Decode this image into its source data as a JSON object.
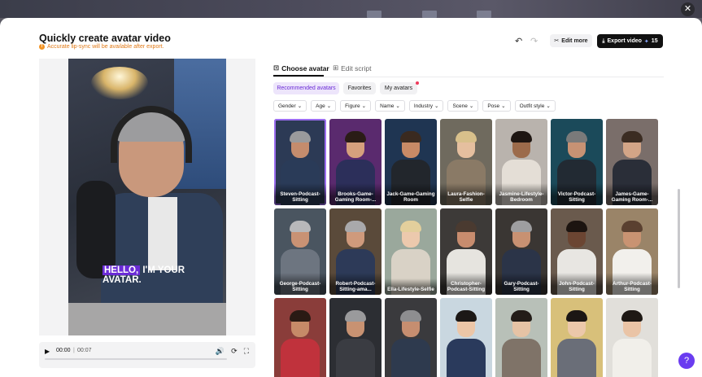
{
  "modal": {
    "title": "Quickly create avatar video",
    "warning": "Accurate lip-sync will be available after export.",
    "edit_more_label": "Edit more",
    "export_label": "Export video",
    "export_credits": "15"
  },
  "preview": {
    "caption_highlight": "HELLO,",
    "caption_line1_rest": " I'M YOUR",
    "caption_line2": "AVATAR."
  },
  "player": {
    "current_time": "00:00",
    "separator": "|",
    "duration": "00:07",
    "progress_fraction": 0.0
  },
  "tabs": [
    {
      "label": "Choose avatar",
      "active": true
    },
    {
      "label": "Edit script",
      "active": false
    }
  ],
  "segments": [
    {
      "label": "Recommended avatars",
      "active": true
    },
    {
      "label": "Favorites",
      "active": false
    },
    {
      "label": "My avatars",
      "active": false
    }
  ],
  "filters": [
    "Gender",
    "Age",
    "Figure",
    "Name",
    "Industry",
    "Scene",
    "Pose",
    "Outfit style"
  ],
  "avatars": [
    {
      "label": "Steven-Podcast-Sitting",
      "selected": true,
      "bg": "#2c3a55",
      "skin": "#c58c6d",
      "hair": "#9a9a9c",
      "cloth": "#2a3b58"
    },
    {
      "label": "Brooks-Game-Gaming Room-...",
      "selected": false,
      "bg": "#5a2a6e",
      "skin": "#d6a07d",
      "hair": "#2a1c16",
      "cloth": "#2c2f5a"
    },
    {
      "label": "Jack-Game-Gaming Room",
      "selected": false,
      "bg": "#1f3552",
      "skin": "#c88a66",
      "hair": "#3a2a20",
      "cloth": "#22262c"
    },
    {
      "label": "Laura-Fashion-Selfie",
      "selected": false,
      "bg": "#6f6a5e",
      "skin": "#e5bf9f",
      "hair": "#d8c08b",
      "cloth": "#8a7a66"
    },
    {
      "label": "Jasmine-Lifestyle-Bedroom",
      "selected": false,
      "bg": "#b9b3ad",
      "skin": "#9c6b4b",
      "hair": "#1e1612",
      "cloth": "#e4ded6"
    },
    {
      "label": "Victor-Podcast-Sitting",
      "selected": false,
      "bg": "#1b4a5a",
      "skin": "#c79274",
      "hair": "#7a7a7a",
      "cloth": "#222a33"
    },
    {
      "label": "James-Game-Gaming Room-...",
      "selected": false,
      "bg": "#7a6e6a",
      "skin": "#d3a587",
      "hair": "#3b2c22",
      "cloth": "#2a2e38"
    },
    {
      "label": "George-Podcast-Sitting",
      "selected": false,
      "bg": "#4a5560",
      "skin": "#c99274",
      "hair": "#b8b8ba",
      "cloth": "#6d7580"
    },
    {
      "label": "Robert-Podcast-Sitting-ama...",
      "selected": false,
      "bg": "#5a4a3a",
      "skin": "#cf9a7c",
      "hair": "#a9a9ab",
      "cloth": "#2d3a58"
    },
    {
      "label": "Ella-Lifestyle-Selfie",
      "selected": false,
      "bg": "#9aa89c",
      "skin": "#ecc9ad",
      "hair": "#e3cf9c",
      "cloth": "#d9d2c6"
    },
    {
      "label": "Christopher-Podcast-Sitting",
      "selected": false,
      "bg": "#3d3a38",
      "skin": "#c88c6e",
      "hair": "#4a3a30",
      "cloth": "#e6e4df"
    },
    {
      "label": "Gary-Podcast-Sitting",
      "selected": false,
      "bg": "#3a3633",
      "skin": "#c89172",
      "hair": "#9e9ea0",
      "cloth": "#2b3448"
    },
    {
      "label": "John-Podcast-Sitting",
      "selected": false,
      "bg": "#6a5a4d",
      "skin": "#6b4532",
      "hair": "#1c1410",
      "cloth": "#e8e6e2"
    },
    {
      "label": "Arthur-Podcast-Sitting",
      "selected": false,
      "bg": "#9a8468",
      "skin": "#c99372",
      "hair": "#5a4030",
      "cloth": "#f2f0ec"
    },
    {
      "label": "",
      "selected": false,
      "bg": "#8a3d3a",
      "skin": "#c68a68",
      "hair": "#2a1a14",
      "cloth": "#c0323c"
    },
    {
      "label": "",
      "selected": false,
      "bg": "#2c2e33",
      "skin": "#c89272",
      "hair": "#9a9a9c",
      "cloth": "#3a3c42"
    },
    {
      "label": "",
      "selected": false,
      "bg": "#3a3a3d",
      "skin": "#c68e70",
      "hair": "#8e8e90",
      "cloth": "#2e3a4e"
    },
    {
      "label": "",
      "selected": false,
      "bg": "#c9d7e0",
      "skin": "#ecc6a7",
      "hair": "#1c1816",
      "cloth": "#2a3a5c"
    },
    {
      "label": "",
      "selected": false,
      "bg": "#b8c0b8",
      "skin": "#e6c3a5",
      "hair": "#231c18",
      "cloth": "#7f7368"
    },
    {
      "label": "",
      "selected": false,
      "bg": "#d8c07a",
      "skin": "#ecc8aa",
      "hair": "#1c1614",
      "cloth": "#6a6e78"
    },
    {
      "label": "",
      "selected": false,
      "bg": "#e1dfda",
      "skin": "#eac4a6",
      "hair": "#1e1814",
      "cloth": "#f1efea"
    }
  ],
  "help_icon": "question-icon"
}
